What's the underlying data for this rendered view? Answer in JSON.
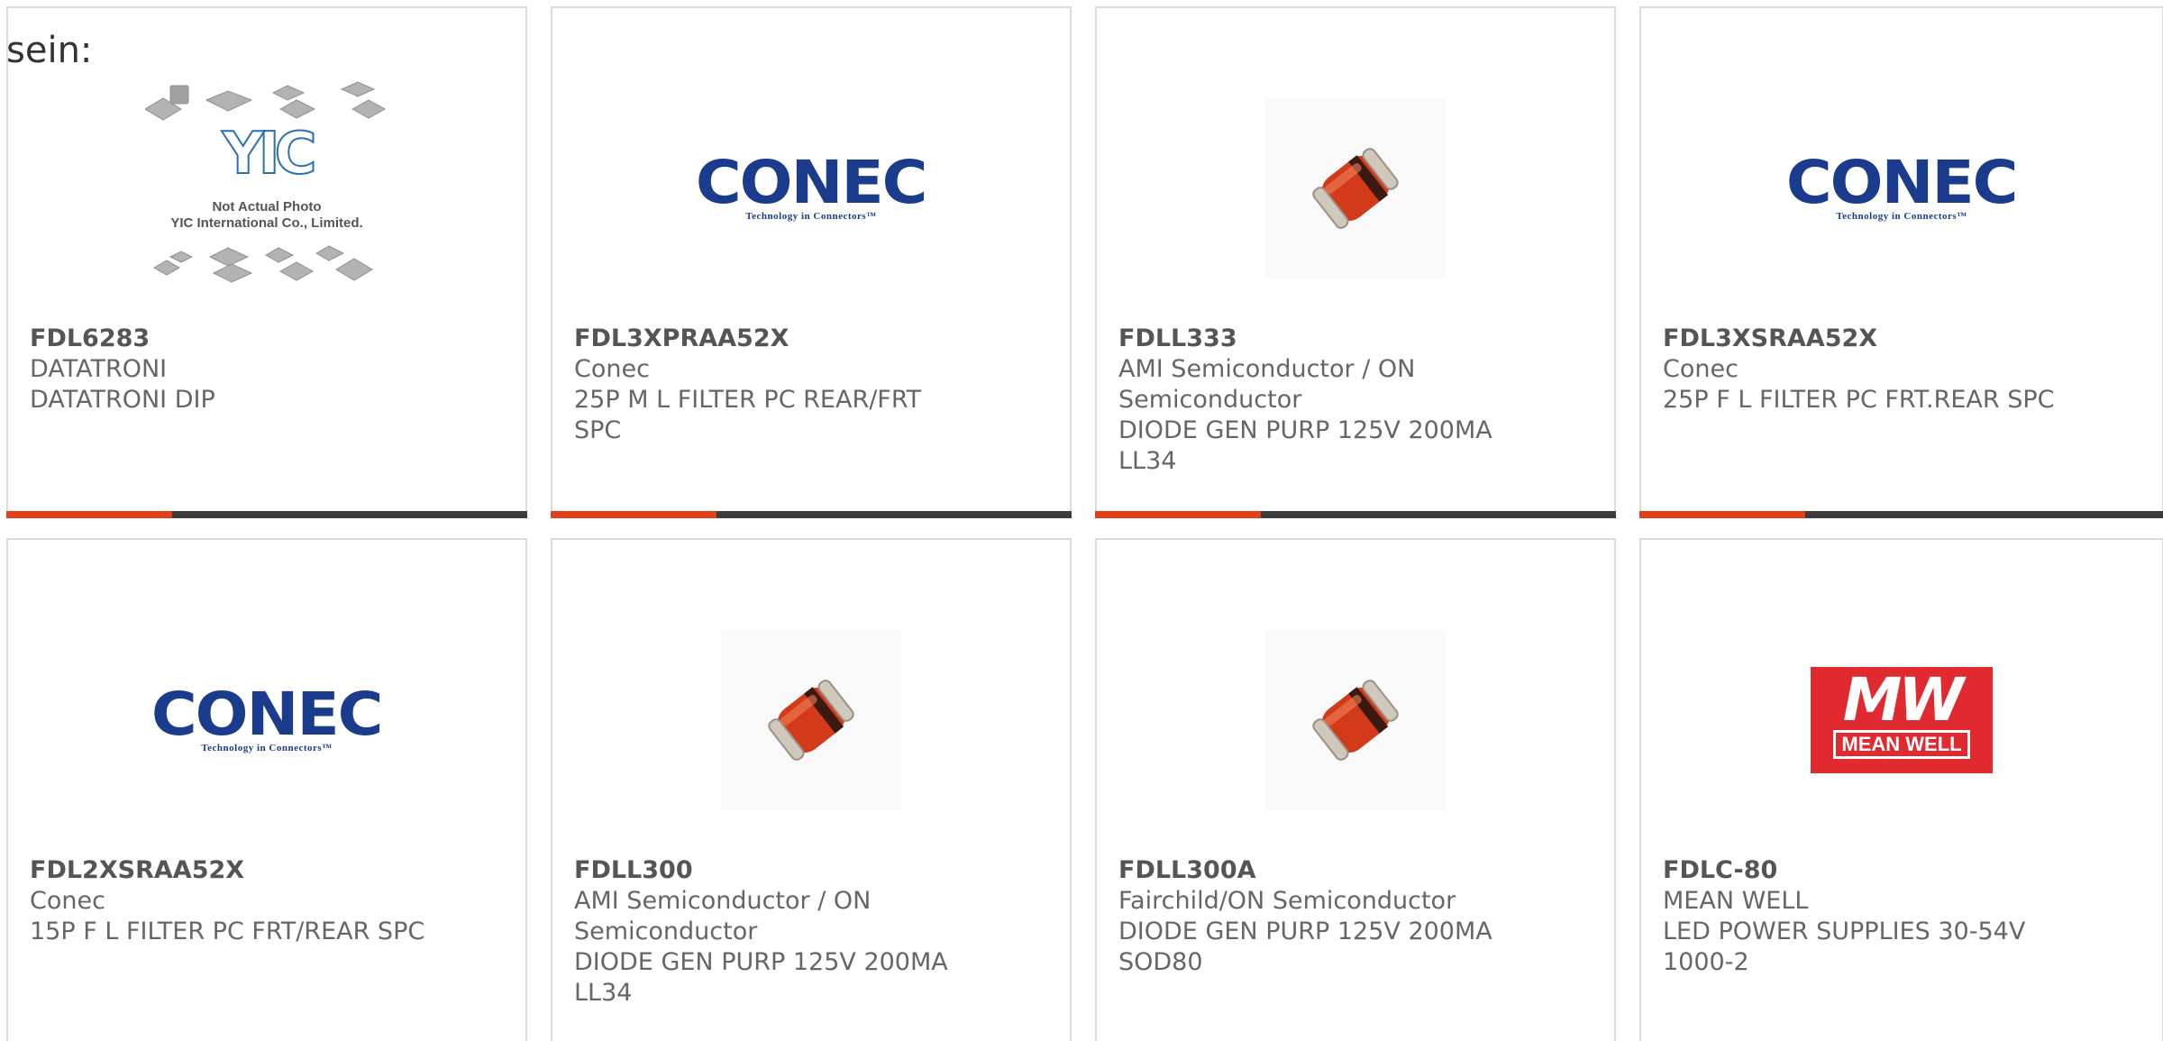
{
  "intro_text": "sein:",
  "colors": {
    "accent_bar": "#e0401a",
    "bar": "#3d3d3d",
    "conec_blue": "#1b3c8c",
    "meanwell_red": "#e02a2f"
  },
  "logos": {
    "conec": {
      "wordmark": "CONEC",
      "tagline": "Technology in Connectors™"
    },
    "meanwell": {
      "big": "MW",
      "small": "MEAN WELL"
    },
    "yic": {
      "logo": "YIC",
      "caption_1": "Not Actual Photo",
      "caption_2": "YIC International Co., Limited."
    }
  },
  "products": [
    {
      "part": "FDL6283",
      "maker": "DATATRONI",
      "desc": [
        "DATATRONI DIP"
      ],
      "image": "yic-placeholder"
    },
    {
      "part": "FDL3XPRAA52X",
      "maker": "Conec",
      "desc": [
        "25P M L FILTER PC REAR/FRT",
        "SPC"
      ],
      "image": "conec-logo"
    },
    {
      "part": "FDLL333",
      "maker": "AMI Semiconductor / ON Semiconductor",
      "desc": [
        "DIODE GEN PURP 125V 200MA",
        "LL34"
      ],
      "image": "diode-photo"
    },
    {
      "part": "FDL3XSRAA52X",
      "maker": "Conec",
      "desc": [
        "25P F L FILTER PC FRT.REAR SPC"
      ],
      "image": "conec-logo"
    },
    {
      "part": "FDL2XSRAA52X",
      "maker": "Conec",
      "desc": [
        "15P F L FILTER PC FRT/REAR SPC"
      ],
      "image": "conec-logo"
    },
    {
      "part": "FDLL300",
      "maker": "AMI Semiconductor / ON Semiconductor",
      "desc": [
        "DIODE GEN PURP 125V 200MA",
        "LL34"
      ],
      "image": "diode-photo"
    },
    {
      "part": "FDLL300A",
      "maker": "Fairchild/ON Semiconductor",
      "desc": [
        "DIODE GEN PURP 125V 200MA",
        "SOD80"
      ],
      "image": "diode-photo"
    },
    {
      "part": "FDLC-80",
      "maker": "MEAN WELL",
      "desc": [
        "LED POWER SUPPLIES 30-54V",
        "1000-2"
      ],
      "image": "meanwell-logo"
    }
  ]
}
